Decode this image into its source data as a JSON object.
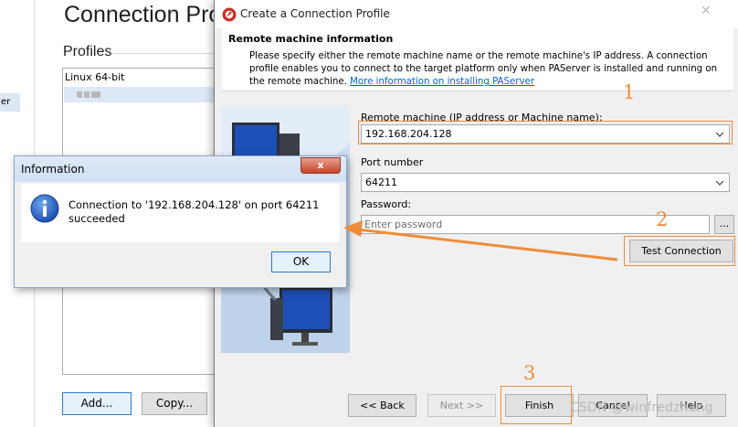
{
  "background_window": {
    "title": "Connection Pro",
    "sidebar_item": "er",
    "profiles_label": "Profiles",
    "profiles": [
      "Linux 64-bit",
      ""
    ],
    "add_label": "Add...",
    "copy_label": "Copy..."
  },
  "profile_dialog": {
    "title": "Create a Connection Profile",
    "header_title": "Remote machine information",
    "header_description": "Please specify either the remote machine name or the remote machine's IP address. A connection profile enables you to connect to the target platform only when PAServer is installed and running on the remote machine.",
    "header_link": "More information on installing PAServer",
    "remote_machine_label": "Remote machine (IP address or Machine name):",
    "remote_machine_value": "192.168.204.128",
    "port_label": "Port number",
    "port_value": "64211",
    "password_label": "Password:",
    "password_placeholder": "Enter password",
    "browse_label": "...",
    "test_connection_label": "Test Connection",
    "back_label": "<< Back",
    "next_label": "Next >>",
    "finish_label": "Finish",
    "cancel_label": "Cancel",
    "help_label": "Help"
  },
  "info_dialog": {
    "title": "Information",
    "close_label": "x",
    "message": "Connection to '192.168.204.128' on port 64211 succeeded",
    "ok_label": "OK"
  },
  "annotations": {
    "step_1": "1",
    "step_2": "2",
    "step_3": "3",
    "color": "#f08c38"
  },
  "watermark": "CSDN @winfredzhang",
  "colors": {
    "accent": "#2a7ad2",
    "link": "#0066cc",
    "annotation": "#f08c38",
    "selection": "#dde8f7"
  },
  "icons": [
    "app-logo-icon",
    "close-icon",
    "chevron-down-icon",
    "info-icon"
  ]
}
